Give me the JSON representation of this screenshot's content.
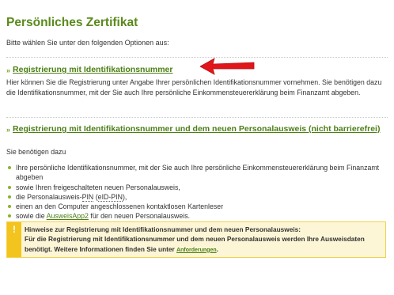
{
  "title": "Persönliches Zertifikat",
  "intro": "Bitte wählen Sie unter den folgenden Optionen aus:",
  "section1": {
    "arrows": "»",
    "link": "Registrierung mit Identifikationsnummer",
    "text": "Hier können Sie die Registrierung unter Angabe Ihrer persönlichen Identifikationsnummer vornehmen. Sie benötigen dazu die Identifikationsnummer, mit der Sie auch Ihre persönliche Einkommensteuererklärung beim Finanzamt abgeben."
  },
  "section2": {
    "arrows": "»",
    "link": "Registrierung mit Identifikationsnummer und dem neuen Personalausweis (nicht barrierefrei)",
    "needs": "Sie benötigen dazu",
    "items": {
      "i1": "Ihre persönliche Identifikationsnummer, mit der Sie auch Ihre persönliche Einkommensteuererklärung beim Finanzamt abgeben",
      "i2": "sowie Ihren freigeschalteten neuen Personalausweis,",
      "i3_pre": "die Personalausweis-",
      "i3_abbr1": "PIN",
      "i3_mid": " (",
      "i3_abbr2": "eID-PIN",
      "i3_post": "),",
      "i4": "einen an den Computer angeschlossenen kontaktlosen Kartenleser",
      "i5_pre": "sowie die ",
      "i5_link": "AusweisApp2",
      "i5_post": " für den neuen Personalausweis."
    }
  },
  "hint": {
    "icon": "!",
    "line1": "Hinweise zur Registrierung mit Identifikationsnummer und dem neuen Personalausweis:",
    "line2": "Für die Registrierung mit Identifikationsnummer und dem neuen Personalausweis werden Ihre Ausweisdaten benötigt. Weitere Informationen finden Sie unter",
    "link": "Anforderungen",
    "end": "."
  },
  "colors": {
    "accent": "#5a8a1c",
    "link": "#4c7e14",
    "warning": "#f3c41e",
    "annotation_arrow": "#e0161b"
  }
}
